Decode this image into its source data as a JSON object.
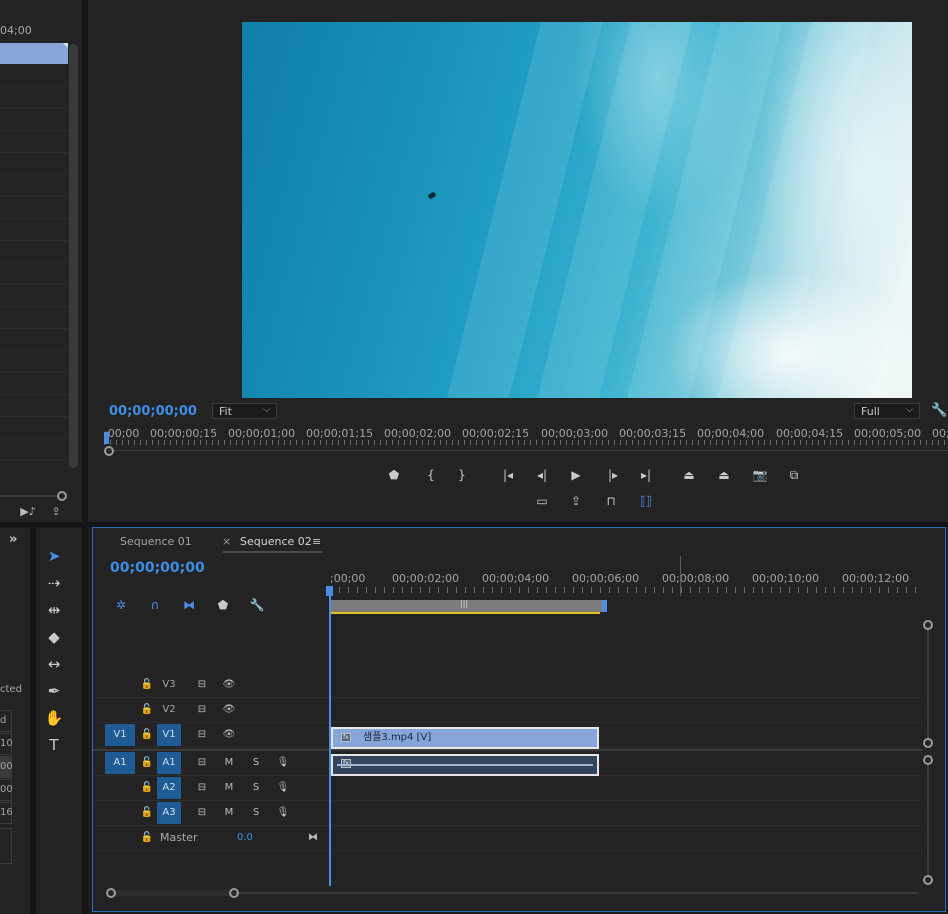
{
  "source_panel": {
    "timecode_fragment": "04;00"
  },
  "program_monitor": {
    "timecode": "00;00;00;00",
    "zoom_select": "Fit",
    "quality_select": "Full",
    "ruler_labels": [
      ":00;00",
      "00;00;00;15",
      "00;00;01;00",
      "00;00;01;15",
      "00;00;02;00",
      "00;00;02;15",
      "00;00;03;00",
      "00;00;03;15",
      "00;00;04;00",
      "00;00;04;15",
      "00;00;05;00",
      "00;"
    ]
  },
  "timeline": {
    "tabs": [
      {
        "label": "Sequence 01",
        "active": false
      },
      {
        "label": "Sequence 02",
        "active": true
      }
    ],
    "timecode": "00;00;00;00",
    "ruler_labels": [
      ";00;00",
      "00;00;02;00",
      "00;00;04;00",
      "00;00;06;00",
      "00;00;08;00",
      "00;00;10;00",
      "00;00;12;00"
    ],
    "tracks": {
      "v3": "V3",
      "v2": "V2",
      "v1": "V1",
      "v1_target": "V1",
      "a1": "A1",
      "a1_target": "A1",
      "a2": "A2",
      "a3": "A3",
      "master": "Master",
      "master_value": "0.0",
      "mute": "M",
      "solo": "S"
    },
    "clip_video_label": "샘플3.mp4 [V]"
  },
  "left_fragments": {
    "cted": "cted",
    "d": "d",
    "n10": "10",
    "n00a": "00",
    "n00b": "00",
    "n16": "16"
  },
  "colors": {
    "accent": "#3b8fe3",
    "target_blue": "#1f5c95",
    "clip_video": "#86a5d8",
    "clip_audio": "#33455e",
    "work_area_bar": "#e3c321"
  }
}
